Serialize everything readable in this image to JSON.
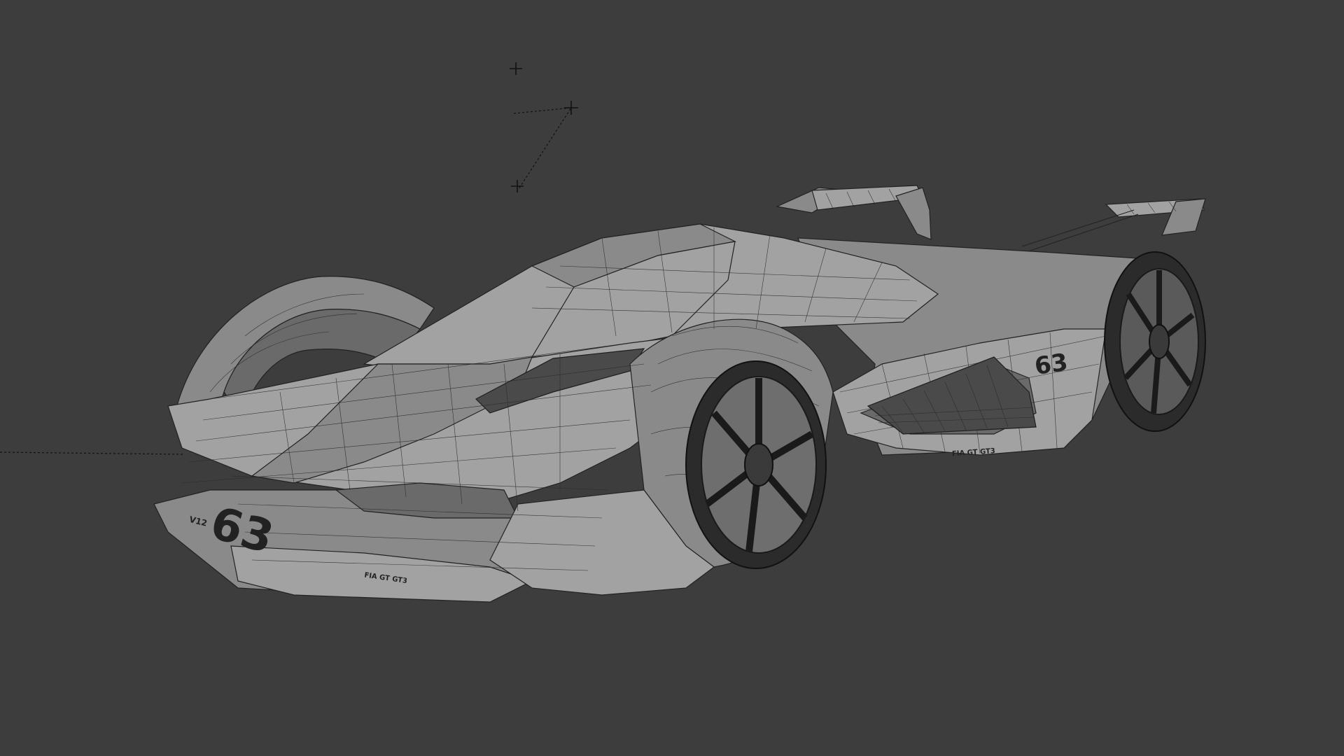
{
  "viewport": {
    "background": "#3d3d3d",
    "shading_mode": "wireframe-overlay",
    "object": "hypercar-mesh"
  },
  "decals": {
    "front_number": "63",
    "side_number": "63",
    "front_logo_small": "V12",
    "side_tagline": "FIA GT GT3"
  },
  "icons": {
    "empty_markers": [
      "plus-cross",
      "plus-cross",
      "plus-cross"
    ],
    "light_helper": "dashed-line"
  },
  "colors": {
    "mesh_light": "#a2a2a2",
    "mesh_mid": "#8a8a8a",
    "mesh_dark": "#6a6a6a",
    "wire": "#232323",
    "wheel_dark": "#2a2a2a"
  }
}
